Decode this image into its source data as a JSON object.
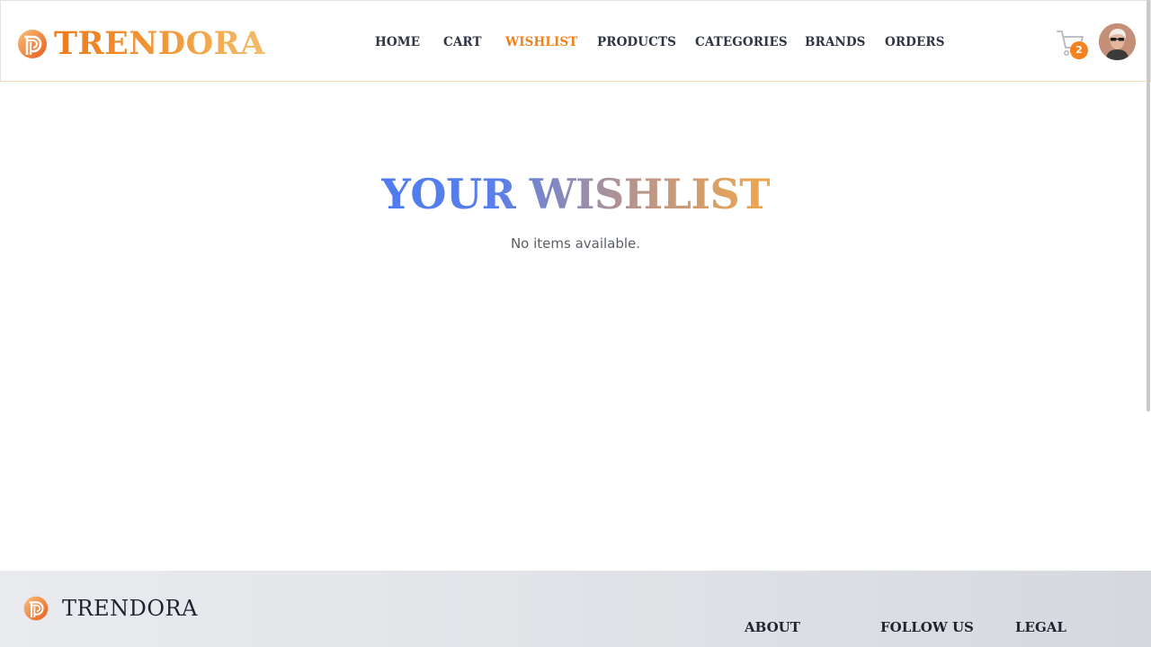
{
  "header": {
    "brand": "TRENDORA",
    "nav": [
      {
        "label": "HOME",
        "active": false
      },
      {
        "label": "CART",
        "active": false
      },
      {
        "label": "WISHLIST",
        "active": true
      },
      {
        "label": "PRODUCTS",
        "active": false
      },
      {
        "label": "CATEGORIES",
        "active": false
      },
      {
        "label": "BRANDS",
        "active": false
      },
      {
        "label": "ORDERS",
        "active": false
      }
    ],
    "cart_count": "2",
    "icons": {
      "cart": "cart-icon",
      "avatar": "user-avatar",
      "logo": "trendora-logo-mark"
    }
  },
  "main": {
    "title": "YOUR WISHLIST",
    "empty_message": "No items available."
  },
  "footer": {
    "brand": "TRENDORA",
    "columns": [
      {
        "title": "ABOUT"
      },
      {
        "title": "FOLLOW US"
      },
      {
        "title": "LEGAL"
      }
    ]
  },
  "colors": {
    "accent": "#f0821e",
    "nav_text": "#2f3542",
    "title_gradient_start": "#4f7cf0",
    "title_gradient_end": "#f0a74b",
    "badge": "#f5821f"
  }
}
